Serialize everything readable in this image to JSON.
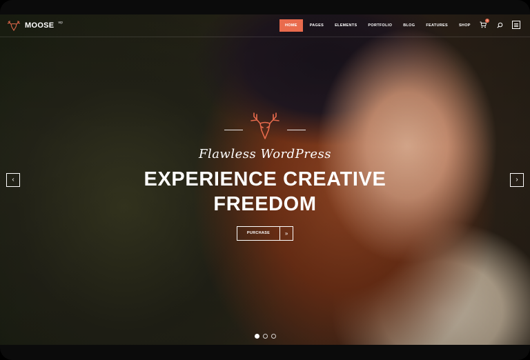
{
  "brand": {
    "name": "MOOSE",
    "sup": "wp"
  },
  "nav": {
    "items": [
      {
        "label": "HOME",
        "active": true
      },
      {
        "label": "PAGES"
      },
      {
        "label": "ELEMENTS"
      },
      {
        "label": "PORTFOLIO"
      },
      {
        "label": "BLOG"
      },
      {
        "label": "FEATURES"
      },
      {
        "label": "SHOP"
      }
    ],
    "cart_count": "0",
    "icons": [
      "cart-icon",
      "search-icon",
      "menu-icon"
    ]
  },
  "hero": {
    "tagline": "Flawless WordPress",
    "headline_line1": "EXPERIENCE CREATIVE",
    "headline_line2": "FREEDOM",
    "cta_label": "PURCHASE",
    "cta_icon": "double-chevron-right-icon",
    "slides": 3,
    "active_slide": 1
  },
  "colors": {
    "accent": "#e96b4d",
    "text": "#ffffff"
  }
}
